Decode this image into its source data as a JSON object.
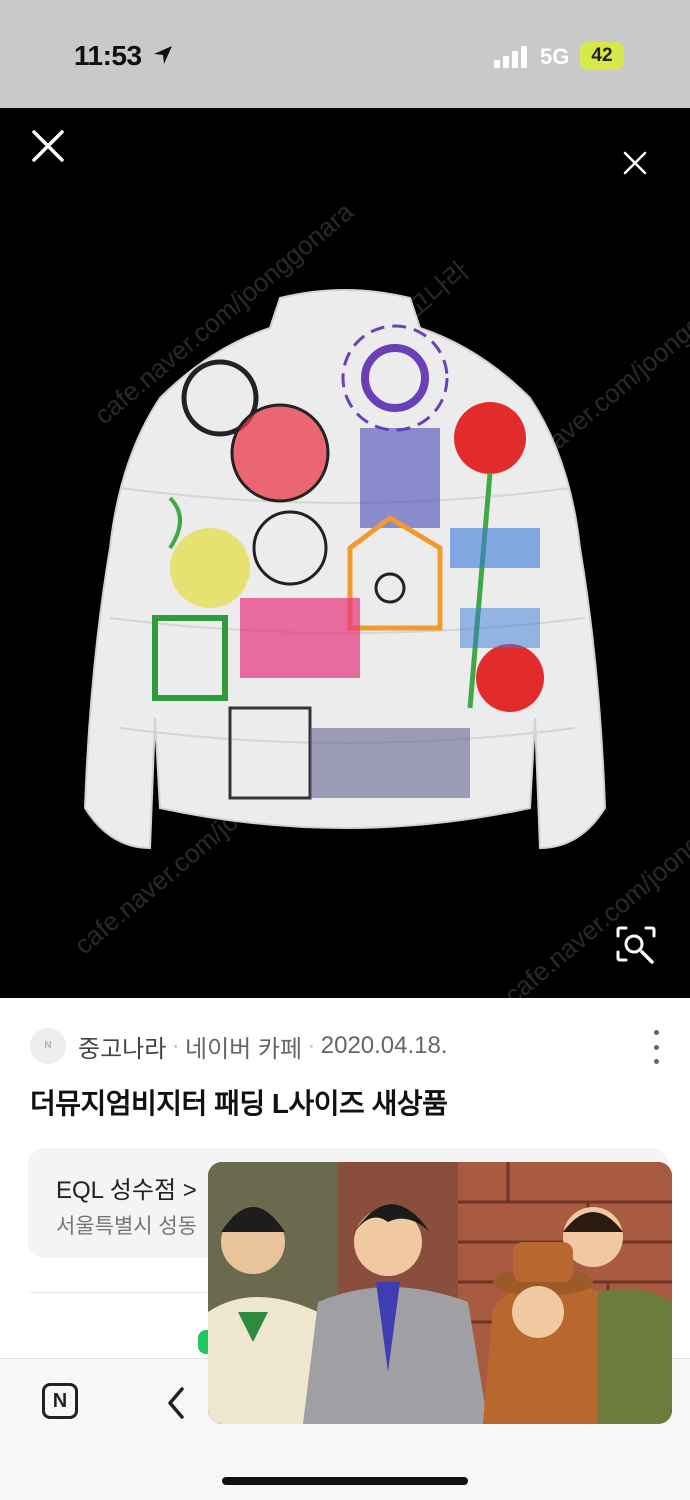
{
  "status_bar": {
    "time": "11:53",
    "network": "5G",
    "battery": "42",
    "icons": [
      "location-arrow-icon",
      "signal-bars-icon",
      "battery-icon"
    ]
  },
  "viewer": {
    "watermark": "cafe.naver.com/joonggonara",
    "watermark_brand": "중고나라",
    "icons": [
      "close-icon",
      "image-search-icon"
    ]
  },
  "result": {
    "source_logo": "N",
    "source_name": "중고나라",
    "separator": "·",
    "source_type": "네이버 카페",
    "date": "2020.04.18.",
    "title": "더뮤지엄비지터 패딩 L사이즈 새상품"
  },
  "shop": {
    "name": "EQL 성수점 >",
    "address": "서울특별시 성동"
  },
  "nav": {
    "n_label": "N",
    "icons": [
      "naver-home-icon",
      "back-chevron-icon"
    ]
  },
  "colors": {
    "status_bg": "#c9c9c9",
    "viewer_bg": "#000000",
    "battery": "#d6e84a",
    "accent_green": "#1ec85e"
  }
}
